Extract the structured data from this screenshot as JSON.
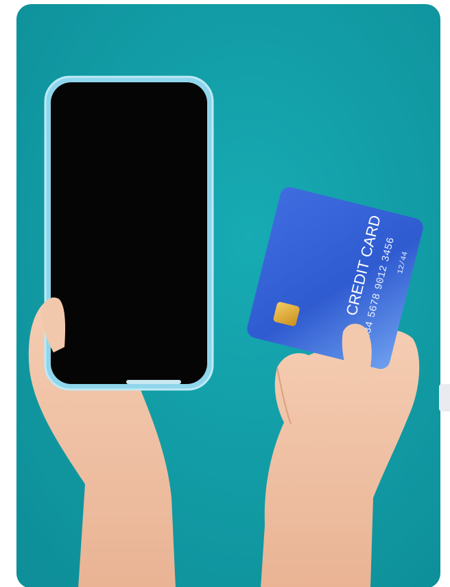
{
  "photo": {
    "subject": "hands holding smartphone and credit card",
    "colors": {
      "background": "#13a0a9",
      "phone_screen": "#050505",
      "phone_case": "#7fd0e8",
      "card_base": "#2f5bd0",
      "card_highlight": "#6fa1f0",
      "chip": "#e2b13c",
      "skin": "#f1c4a6"
    },
    "card": {
      "title": "CREDIT CARD",
      "number_group_1": "1234",
      "number_group_2": "5678",
      "number_group_3": "9012",
      "number_group_4": "3456",
      "expiry": "12/44"
    }
  }
}
